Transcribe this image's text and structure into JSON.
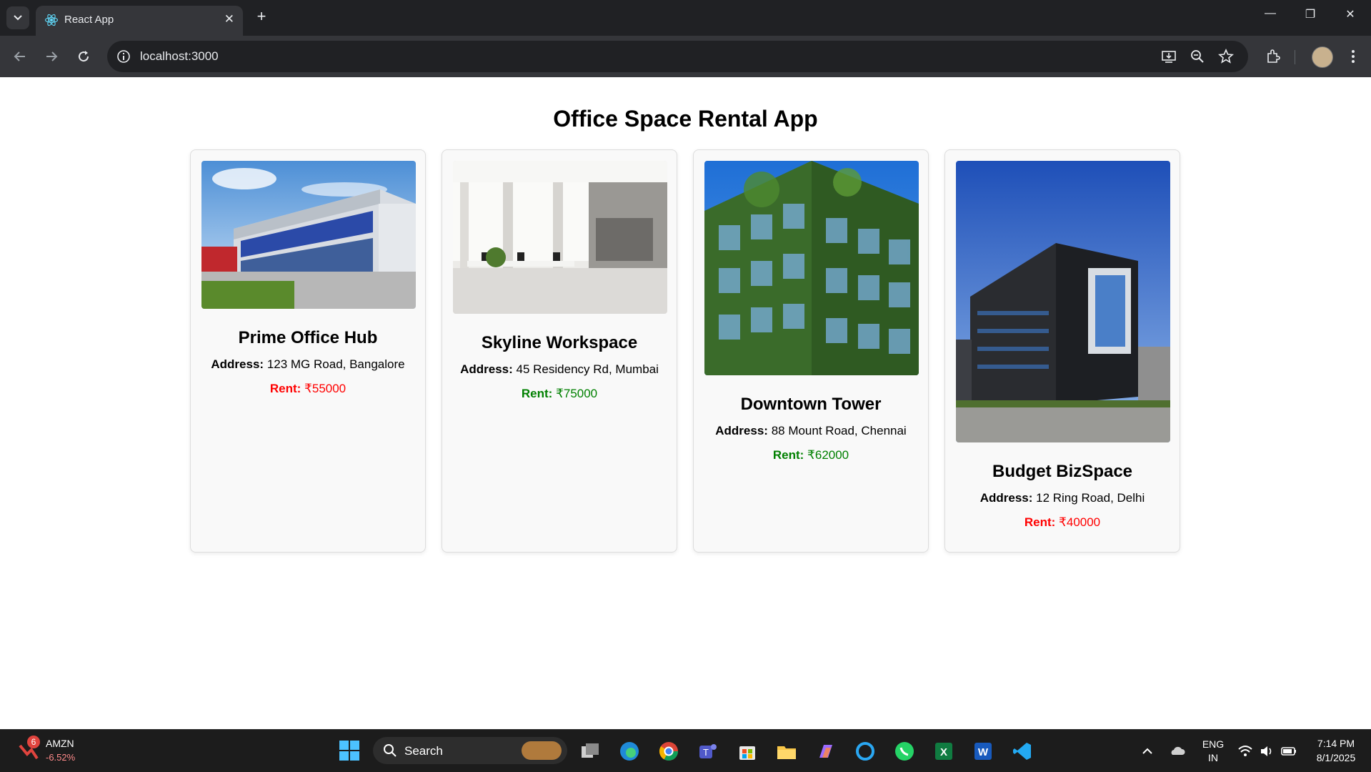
{
  "browser": {
    "tab_title": "React App",
    "url": "localhost:3000"
  },
  "page": {
    "title": "Office Space Rental App",
    "address_label": "Address:",
    "rent_label": "Rent:",
    "offices": [
      {
        "name": "Prime Office Hub",
        "address": "123 MG Road, Bangalore",
        "rent": "₹55000",
        "rent_color": "#ff0000"
      },
      {
        "name": "Skyline Workspace",
        "address": "45 Residency Rd, Mumbai",
        "rent": "₹75000",
        "rent_color": "#008000"
      },
      {
        "name": "Downtown Tower",
        "address": "88 Mount Road, Chennai",
        "rent": "₹62000",
        "rent_color": "#008000"
      },
      {
        "name": "Budget BizSpace",
        "address": "12 Ring Road, Delhi",
        "rent": "₹40000",
        "rent_color": "#ff0000"
      }
    ]
  },
  "taskbar": {
    "stock_ticker": "AMZN",
    "stock_change": "-6.52%",
    "stock_badge": "6",
    "search_label": "Search",
    "lang_line1": "ENG",
    "lang_line2": "IN",
    "time": "7:14 PM",
    "date": "8/1/2025"
  }
}
